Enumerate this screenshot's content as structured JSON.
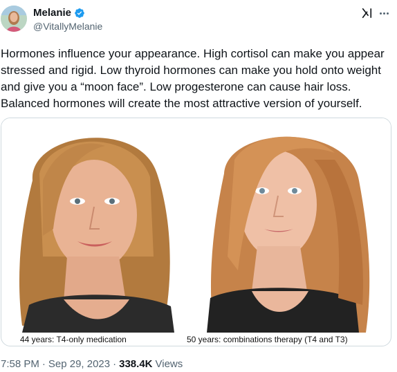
{
  "author": {
    "display_name": "Melanie",
    "handle": "@VitallyMelanie",
    "verified": true,
    "avatar_icon": "profile-photo"
  },
  "header_icons": {
    "grok": "grok-icon",
    "more": "more-options-icon"
  },
  "tweet": {
    "text": "Hormones influence your appearance. High cortisol can make you appear stressed and rigid. Low thyroid hormones can make you hold onto weight and give you a “moon face”. Low progesterone can cause hair loss. Balanced hormones will create the most attractive version of yourself."
  },
  "media": {
    "left_caption": "44 years: T4-only medication",
    "right_caption": "50 years: combinations therapy (T4 and T3)"
  },
  "meta": {
    "time": "7:58 PM",
    "separator1": "·",
    "date": "Sep 29, 2023",
    "separator2": "·",
    "views_count": "338.4K",
    "views_label": "Views"
  },
  "colors": {
    "text": "#0f1419",
    "secondary": "#536471",
    "verified_blue": "#1d9bf0",
    "border": "#cfd9de"
  }
}
